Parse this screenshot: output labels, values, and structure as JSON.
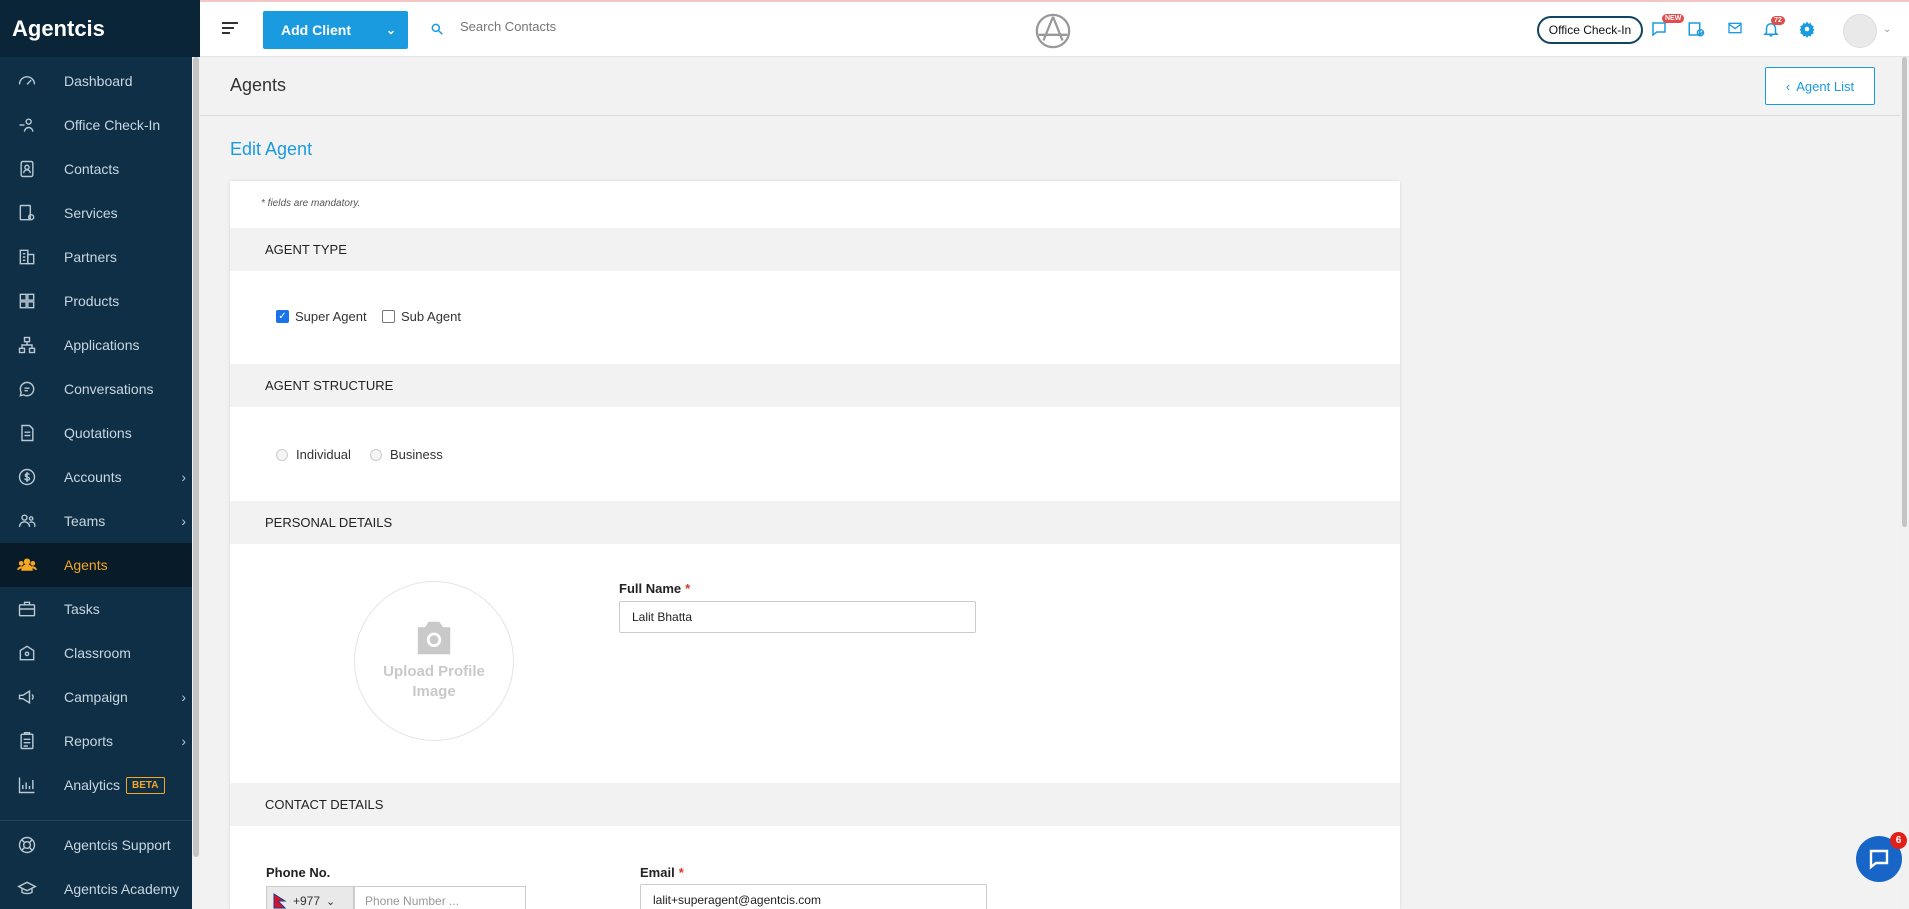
{
  "app": {
    "brand": "Agentcis"
  },
  "sidebar": {
    "items": [
      {
        "label": "Dashboard",
        "icon": "gauge-icon"
      },
      {
        "label": "Office Check-In",
        "icon": "checkin-icon"
      },
      {
        "label": "Contacts",
        "icon": "contacts-icon"
      },
      {
        "label": "Services",
        "icon": "services-icon"
      },
      {
        "label": "Partners",
        "icon": "building-icon"
      },
      {
        "label": "Products",
        "icon": "products-icon"
      },
      {
        "label": "Applications",
        "icon": "flow-icon"
      },
      {
        "label": "Conversations",
        "icon": "chat-icon"
      },
      {
        "label": "Quotations",
        "icon": "document-icon"
      },
      {
        "label": "Accounts",
        "icon": "dollar-icon"
      },
      {
        "label": "Teams",
        "icon": "team-icon"
      },
      {
        "label": "Agents",
        "icon": "agents-icon"
      },
      {
        "label": "Tasks",
        "icon": "briefcase-icon"
      },
      {
        "label": "Classroom",
        "icon": "classroom-icon"
      },
      {
        "label": "Campaign",
        "icon": "megaphone-icon"
      },
      {
        "label": "Reports",
        "icon": "clipboard-icon"
      },
      {
        "label": "Analytics",
        "icon": "analytics-icon",
        "badge": "BETA"
      }
    ],
    "footer": [
      {
        "label": "Agentcis Support",
        "icon": "lifebuoy-icon"
      },
      {
        "label": "Agentcis Academy",
        "icon": "academy-icon"
      }
    ]
  },
  "topbar": {
    "add_client_label": "Add Client",
    "search_placeholder": "Search Contacts",
    "office_checkin_label": "Office Check-In",
    "new_badge": "NEW",
    "notification_count": "72"
  },
  "page": {
    "title": "Agents",
    "agent_list_label": "Agent List",
    "heading": "Edit Agent"
  },
  "form": {
    "mandatory_note": "* fields are mandatory.",
    "sections": {
      "agent_type": "AGENT TYPE",
      "agent_structure": "AGENT STRUCTURE",
      "personal_details": "PERSONAL DETAILS",
      "contact_details": "CONTACT DETAILS"
    },
    "agent_type": {
      "super_agent": {
        "label": "Super Agent",
        "checked": true
      },
      "sub_agent": {
        "label": "Sub Agent",
        "checked": false
      }
    },
    "agent_structure": {
      "individual": "Individual",
      "business": "Business"
    },
    "upload_text": "Upload Profile Image",
    "full_name": {
      "label": "Full Name",
      "value": "Lalit Bhatta"
    },
    "phone": {
      "label": "Phone No.",
      "code": "+977",
      "placeholder": "Phone Number ..."
    },
    "email": {
      "label": "Email",
      "value": "lalit+superagent@agentcis.com"
    }
  },
  "chat_widget": {
    "unread": "6"
  },
  "colors": {
    "accent": "#1a9be0",
    "sidebar": "#0e2f45",
    "active": "#f5a623",
    "required": "#d9342b"
  }
}
